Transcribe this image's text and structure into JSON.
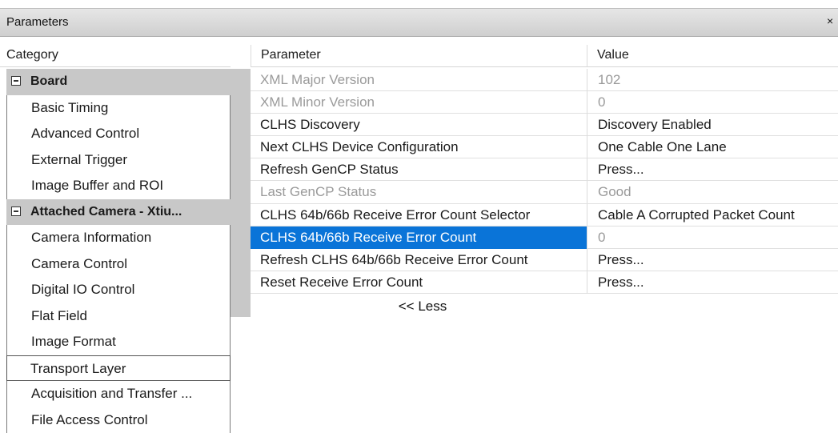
{
  "window": {
    "title": "Parameters",
    "close_glyph": "×"
  },
  "headers": {
    "category": "Category",
    "parameter": "Parameter",
    "value": "Value"
  },
  "categories": [
    {
      "type": "group",
      "label": "Board"
    },
    {
      "type": "item",
      "label": "Basic Timing"
    },
    {
      "type": "item",
      "label": "Advanced Control"
    },
    {
      "type": "item",
      "label": "External Trigger"
    },
    {
      "type": "item",
      "label": "Image Buffer and ROI"
    },
    {
      "type": "group",
      "label": "Attached Camera - Xtiu..."
    },
    {
      "type": "item",
      "label": "Camera Information"
    },
    {
      "type": "item",
      "label": "Camera Control"
    },
    {
      "type": "item",
      "label": "Digital IO Control"
    },
    {
      "type": "item",
      "label": "Flat Field"
    },
    {
      "type": "item",
      "label": "Image Format"
    },
    {
      "type": "item",
      "label": "Transport Layer",
      "selected": true
    },
    {
      "type": "item",
      "label": "Acquisition and Transfer ..."
    },
    {
      "type": "item",
      "label": "File Access Control"
    }
  ],
  "parameters": [
    {
      "name": "XML Major Version",
      "value": "102",
      "disabled": true
    },
    {
      "name": "XML Minor Version",
      "value": "0",
      "disabled": true
    },
    {
      "name": "CLHS Discovery",
      "value": "Discovery Enabled"
    },
    {
      "name": "Next CLHS Device Configuration",
      "value": "One Cable One Lane"
    },
    {
      "name": "Refresh GenCP Status",
      "value": "Press..."
    },
    {
      "name": "Last GenCP Status",
      "value": "Good",
      "disabled": true
    },
    {
      "name": "CLHS 64b/66b Receive Error Count Selector",
      "value": "Cable A Corrupted Packet Count"
    },
    {
      "name": "CLHS 64b/66b Receive Error Count",
      "value": "0",
      "selected": true
    },
    {
      "name": "Refresh CLHS 64b/66b Receive Error Count",
      "value": "Press..."
    },
    {
      "name": "Reset Receive Error Count",
      "value": "Press..."
    }
  ],
  "less_link": "<< Less",
  "colors": {
    "selection": "#0a74d8",
    "group_bg": "#c8c8c8",
    "disabled_text": "#9a9a9a"
  },
  "icons": {
    "group_expander": "collapse-minus-icon",
    "close": "close-icon"
  }
}
